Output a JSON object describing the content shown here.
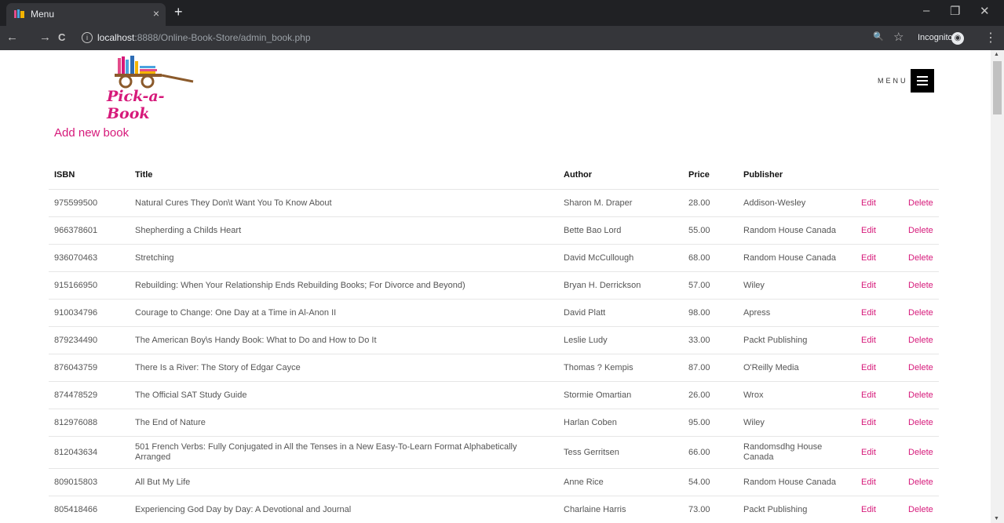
{
  "browser": {
    "tab_title": "Menu",
    "tab_close": "×",
    "new_tab": "+",
    "url_host": "localhost",
    "url_path": ":8888/Online-Book-Store/admin_book.php",
    "incognito_label": "Incognito",
    "icons": {
      "back": "←",
      "forward": "→",
      "reload": "C",
      "info": "i",
      "zoom": "🔍",
      "star": "☆",
      "kebab": "⋮",
      "minimize": "–",
      "restore": "❐",
      "close": "✕"
    }
  },
  "header": {
    "logo_text": "Pick-a-Book",
    "menu_label": "MENU"
  },
  "main": {
    "add_link": "Add new book",
    "columns": [
      "ISBN",
      "Title",
      "Author",
      "Price",
      "Publisher"
    ],
    "edit_label": "Edit",
    "delete_label": "Delete",
    "rows": [
      {
        "isbn": "975599500",
        "title": "Natural Cures They Don\\t Want You To Know About",
        "author": "Sharon M. Draper",
        "price": "28.00",
        "publisher": "Addison-Wesley"
      },
      {
        "isbn": "966378601",
        "title": "Shepherding a Childs Heart",
        "author": "Bette Bao Lord",
        "price": "55.00",
        "publisher": "Random House Canada"
      },
      {
        "isbn": "936070463",
        "title": "Stretching",
        "author": "David McCullough",
        "price": "68.00",
        "publisher": "Random House Canada"
      },
      {
        "isbn": "915166950",
        "title": "Rebuilding: When Your Relationship Ends Rebuilding Books; For Divorce and Beyond)",
        "author": "Bryan H. Derrickson",
        "price": "57.00",
        "publisher": "Wiley"
      },
      {
        "isbn": "910034796",
        "title": "Courage to Change: One Day at a Time in Al-Anon II",
        "author": "David Platt",
        "price": "98.00",
        "publisher": "Apress"
      },
      {
        "isbn": "879234490",
        "title": "The American Boy\\s Handy Book: What to Do and How to Do It",
        "author": "Leslie Ludy",
        "price": "33.00",
        "publisher": "Packt Publishing"
      },
      {
        "isbn": "876043759",
        "title": "There Is a River: The Story of Edgar Cayce",
        "author": "Thomas ? Kempis",
        "price": "87.00",
        "publisher": "O'Reilly Media"
      },
      {
        "isbn": "874478529",
        "title": "The Official SAT Study Guide",
        "author": "Stormie Omartian",
        "price": "26.00",
        "publisher": "Wrox"
      },
      {
        "isbn": "812976088",
        "title": "The End of Nature",
        "author": "Harlan Coben",
        "price": "95.00",
        "publisher": "Wiley"
      },
      {
        "isbn": "812043634",
        "title": "501 French Verbs: Fully Conjugated in All the Tenses in a New Easy-To-Learn Format Alphabetically Arranged",
        "author": "Tess Gerritsen",
        "price": "66.00",
        "publisher": "Randomsdhg House Canada"
      },
      {
        "isbn": "809015803",
        "title": "All But My Life",
        "author": "Anne Rice",
        "price": "54.00",
        "publisher": "Random House Canada"
      },
      {
        "isbn": "805418466",
        "title": "Experiencing God Day by Day: A Devotional and Journal",
        "author": "Charlaine Harris",
        "price": "73.00",
        "publisher": "Packt Publishing"
      }
    ]
  },
  "colors": {
    "accent": "#d6197a",
    "chrome_dark": "#202124",
    "chrome_toolbar": "#35363a"
  }
}
